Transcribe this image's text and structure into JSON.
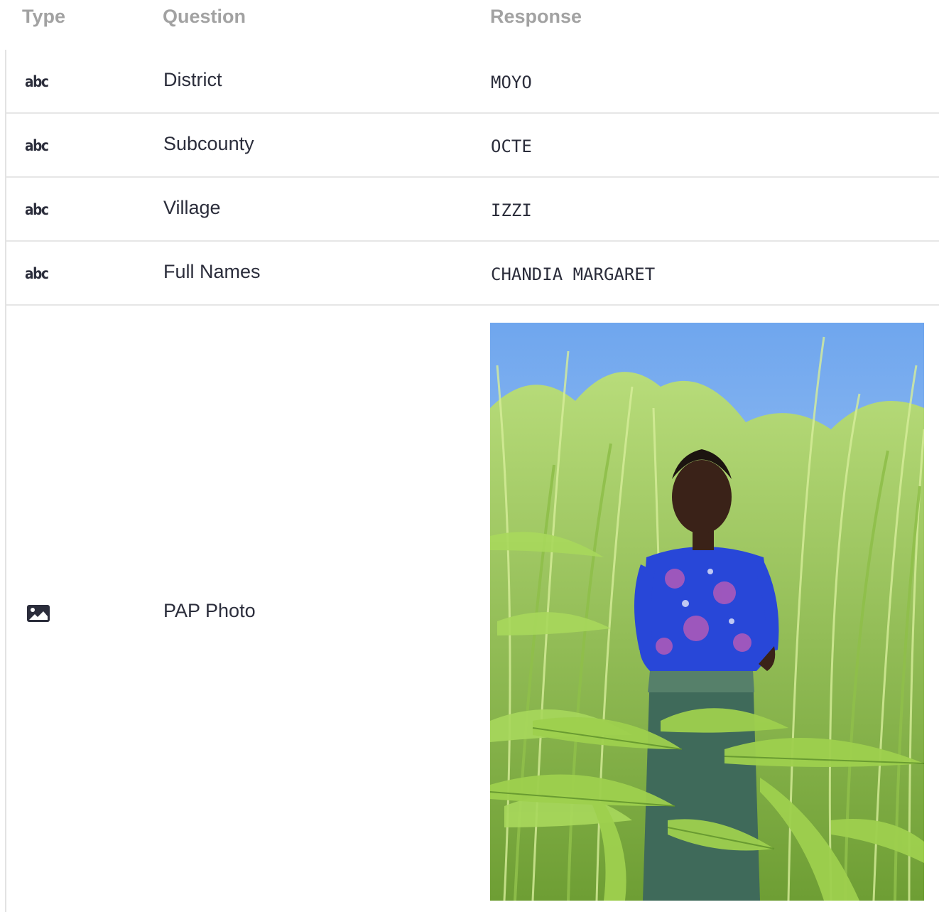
{
  "header": {
    "type_label": "Type",
    "question_label": "Question",
    "response_label": "Response"
  },
  "rows": [
    {
      "type_text": "abc",
      "type_icon": "text-type-icon",
      "question": "District",
      "response": "MOYO"
    },
    {
      "type_text": "abc",
      "type_icon": "text-type-icon",
      "question": "Subcounty",
      "response": "OCTE"
    },
    {
      "type_text": "abc",
      "type_icon": "text-type-icon",
      "question": "Village",
      "response": "IZZI"
    },
    {
      "type_text": "abc",
      "type_icon": "text-type-icon",
      "question": "Full Names",
      "response": "CHANDIA MARGARET"
    }
  ],
  "photo_row": {
    "type_icon": "image-type-icon",
    "question": "PAP Photo",
    "response_kind": "photo"
  },
  "colors": {
    "header_text": "#a2a2a2",
    "body_text": "#2b2d3b",
    "row_divider": "#e6e6e6",
    "sky": "#7fb4f0",
    "foliage": "#9fd35a",
    "dress": "#2847d8"
  }
}
